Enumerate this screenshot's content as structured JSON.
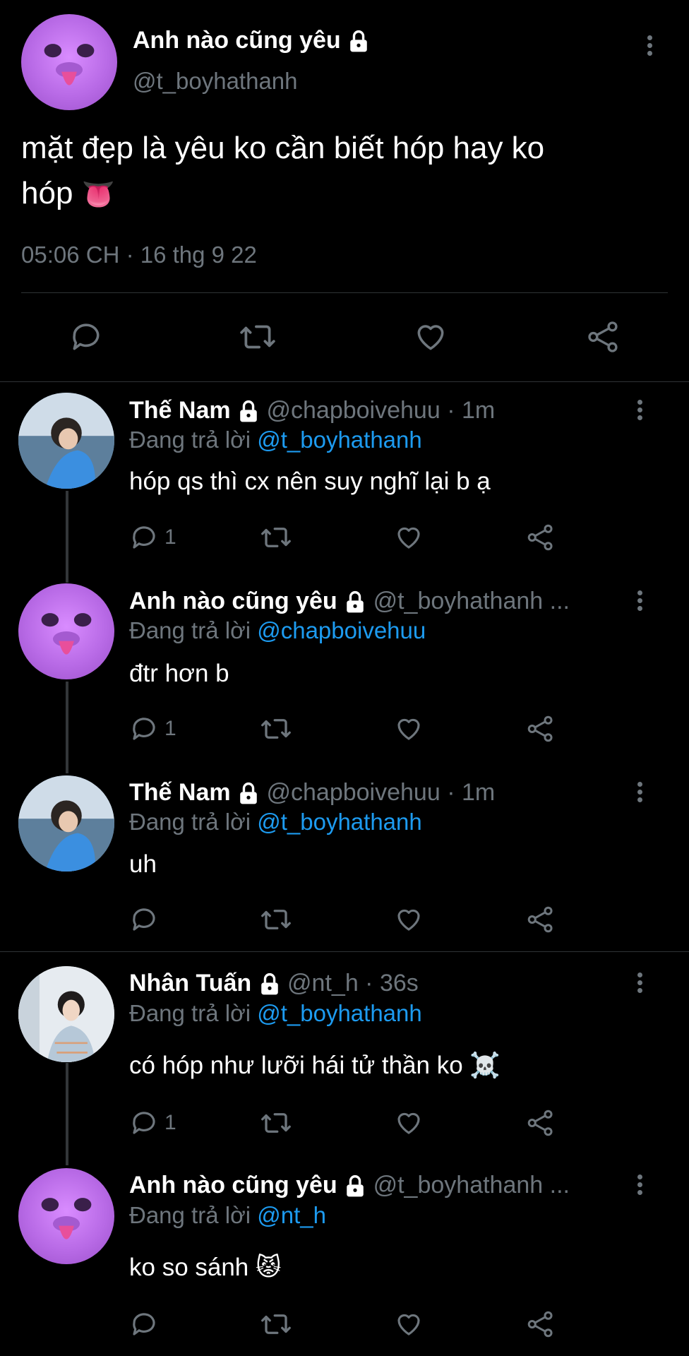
{
  "main_tweet": {
    "name": "Anh nào cũng yêu",
    "handle": "@t_boyhathanh",
    "text_line1": "mặt đẹp là yêu ko cần biết hóp hay ko",
    "text_line2": "hóp",
    "emoji": "👅",
    "timestamp": "05:06 CH · 16 thg 9 22"
  },
  "reply_prefix": "Đang trả lời",
  "replies": [
    {
      "name": "Thế Nam",
      "meta": "@chapboivehuu · 1m",
      "reply_to": "@t_boyhathanh",
      "text": "hóp qs thì cx nên suy nghĩ lại b ạ",
      "reply_count": "1"
    },
    {
      "name": "Anh nào cũng yêu",
      "meta": "@t_boyhathanh ...",
      "reply_to": "@chapboivehuu",
      "text": "đtr hơn b",
      "reply_count": "1"
    },
    {
      "name": "Thế Nam",
      "meta": "@chapboivehuu · 1m",
      "reply_to": "@t_boyhathanh",
      "text": "uh",
      "reply_count": ""
    },
    {
      "name": "Nhân Tuấn",
      "meta": "@nt_h · 36s",
      "reply_to": "@t_boyhathanh",
      "text": "có hóp như lưỡi hái tử thần ko ☠️",
      "reply_count": "1"
    },
    {
      "name": "Anh nào cũng yêu",
      "meta": "@t_boyhathanh ...",
      "reply_to": "@nt_h",
      "text": "ko so sánh 😾",
      "reply_count": ""
    }
  ],
  "colors": {
    "background": "#000000",
    "text": "#ffffff",
    "muted": "#6e767d",
    "link": "#1d9bf0",
    "divider": "#2f3336"
  }
}
